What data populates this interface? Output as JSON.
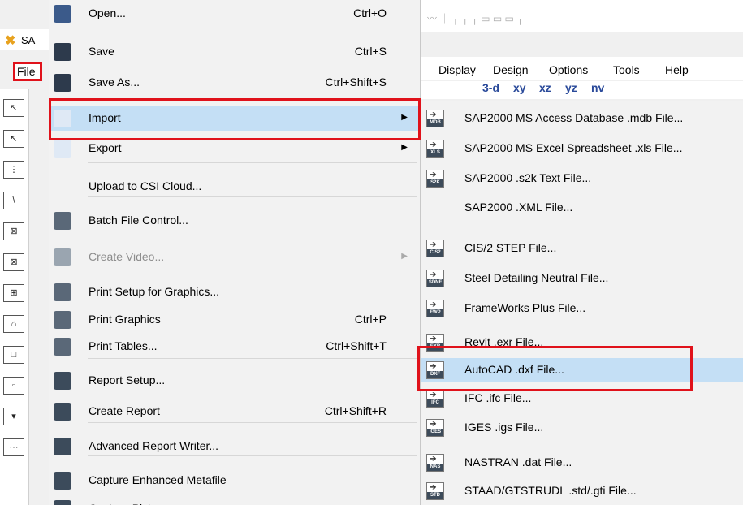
{
  "app": {
    "title_fragment": "SA",
    "file_menu_label": "File",
    "menubar": [
      "Display",
      "Design",
      "Options",
      "Tools",
      "Help"
    ],
    "view_toolbar": [
      "3-d",
      "xy",
      "xz",
      "yz",
      "nv"
    ]
  },
  "left_toolbar": [
    "↖",
    "↖",
    "⋮",
    "\\",
    "⊠",
    "⊠",
    "⊞",
    "⌂",
    "□",
    "▫",
    "▾",
    "⋯"
  ],
  "menu": {
    "items": [
      {
        "label": "Open...",
        "shortcut": "Ctrl+O",
        "icon": "open-folder-icon",
        "has_submenu": false,
        "disabled": false
      },
      {
        "label": "Save",
        "shortcut": "Ctrl+S",
        "icon": "save-disk-icon",
        "has_submenu": false,
        "disabled": false
      },
      {
        "label": "Save As...",
        "shortcut": "Ctrl+Shift+S",
        "icon": "save-as-icon",
        "has_submenu": false,
        "disabled": false
      },
      {
        "label": "Import",
        "shortcut": "",
        "icon": "import-icon",
        "has_submenu": true,
        "disabled": false
      },
      {
        "label": "Export",
        "shortcut": "",
        "icon": "export-icon",
        "has_submenu": true,
        "disabled": false
      },
      {
        "label": "Upload to CSI Cloud...",
        "shortcut": "",
        "icon": "",
        "has_submenu": false,
        "disabled": false
      },
      {
        "label": "Batch File Control...",
        "shortcut": "",
        "icon": "batch-control-icon",
        "has_submenu": false,
        "disabled": false
      },
      {
        "label": "Create Video...",
        "shortcut": "",
        "icon": "video-icon",
        "has_submenu": true,
        "disabled": true
      },
      {
        "label": "Print Setup for Graphics...",
        "shortcut": "",
        "icon": "print-setup-icon",
        "has_submenu": false,
        "disabled": false
      },
      {
        "label": "Print Graphics",
        "shortcut": "Ctrl+P",
        "icon": "printer-icon",
        "has_submenu": false,
        "disabled": false
      },
      {
        "label": "Print Tables...",
        "shortcut": "Ctrl+Shift+T",
        "icon": "print-tables-icon",
        "has_submenu": false,
        "disabled": false
      },
      {
        "label": "Report Setup...",
        "shortcut": "",
        "icon": "report-setup-icon",
        "has_submenu": false,
        "disabled": false
      },
      {
        "label": "Create Report",
        "shortcut": "Ctrl+Shift+R",
        "icon": "create-report-icon",
        "has_submenu": false,
        "disabled": false
      },
      {
        "label": "Advanced Report Writer...",
        "shortcut": "",
        "icon": "report-writer-icon",
        "has_submenu": false,
        "disabled": false
      },
      {
        "label": "Capture Enhanced Metafile",
        "shortcut": "",
        "icon": "metafile-icon",
        "has_submenu": false,
        "disabled": false
      },
      {
        "label": "Capture Picture",
        "shortcut": "",
        "icon": "picture-icon",
        "has_submenu": false,
        "disabled": false
      }
    ]
  },
  "submenu": {
    "items": [
      {
        "label": "SAP2000 MS Access Database .mdb File...",
        "tag": "MDB"
      },
      {
        "label": "SAP2000 MS Excel Spreadsheet .xls File...",
        "tag": "XLS"
      },
      {
        "label": "SAP2000 .s2k Text File...",
        "tag": "S2K"
      },
      {
        "label": "SAP2000 .XML File...",
        "tag": ""
      },
      {
        "label": "CIS/2 STEP File...",
        "tag": "CIS2"
      },
      {
        "label": "Steel Detailing Neutral File...",
        "tag": "SDNF"
      },
      {
        "label": "FrameWorks Plus File...",
        "tag": "FWP"
      },
      {
        "label": "Revit .exr File...",
        "tag": "EXR"
      },
      {
        "label": "AutoCAD .dxf File...",
        "tag": "DXF"
      },
      {
        "label": "IFC .ifc File...",
        "tag": "IFC"
      },
      {
        "label": "IGES .igs File...",
        "tag": "IGES"
      },
      {
        "label": "NASTRAN .dat File...",
        "tag": "NAS"
      },
      {
        "label": "STAAD/GTSTRUDL .std/.gti File...",
        "tag": "STD"
      }
    ]
  },
  "colors": {
    "highlight": "#c4dff5",
    "annotation_red": "#e0121b",
    "menu_bg": "#f2f2f2"
  }
}
